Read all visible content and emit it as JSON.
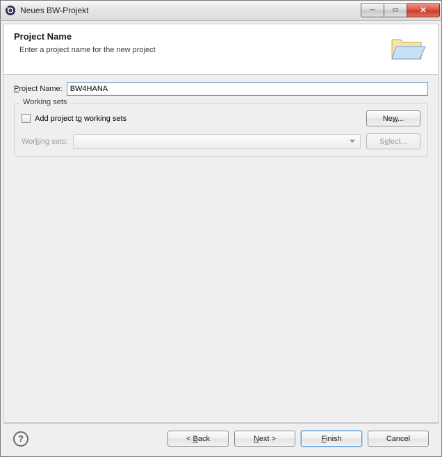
{
  "window": {
    "title": "Neues BW-Projekt"
  },
  "banner": {
    "title": "Project Name",
    "subtitle": "Enter a project name for the new project"
  },
  "form": {
    "project_name_label_pre": "P",
    "project_name_label_rest": "roject Name:",
    "project_name_value": "BW4HANA"
  },
  "group": {
    "legend": "Working sets",
    "checkbox_pre": "Add project t",
    "checkbox_mn": "o",
    "checkbox_post": " working sets",
    "ws_label_pre": "Wor",
    "ws_label_mn": "k",
    "ws_label_post": "ing sets:",
    "new_btn_pre": "Ne",
    "new_btn_mn": "w",
    "new_btn_post": "...",
    "select_btn_pre": "S",
    "select_btn_mn": "e",
    "select_btn_post": "lect..."
  },
  "buttons": {
    "back_pre": "< ",
    "back_mn": "B",
    "back_post": "ack",
    "next_pre": "",
    "next_mn": "N",
    "next_post": "ext >",
    "finish_pre": "",
    "finish_mn": "F",
    "finish_post": "inish",
    "cancel": "Cancel"
  }
}
